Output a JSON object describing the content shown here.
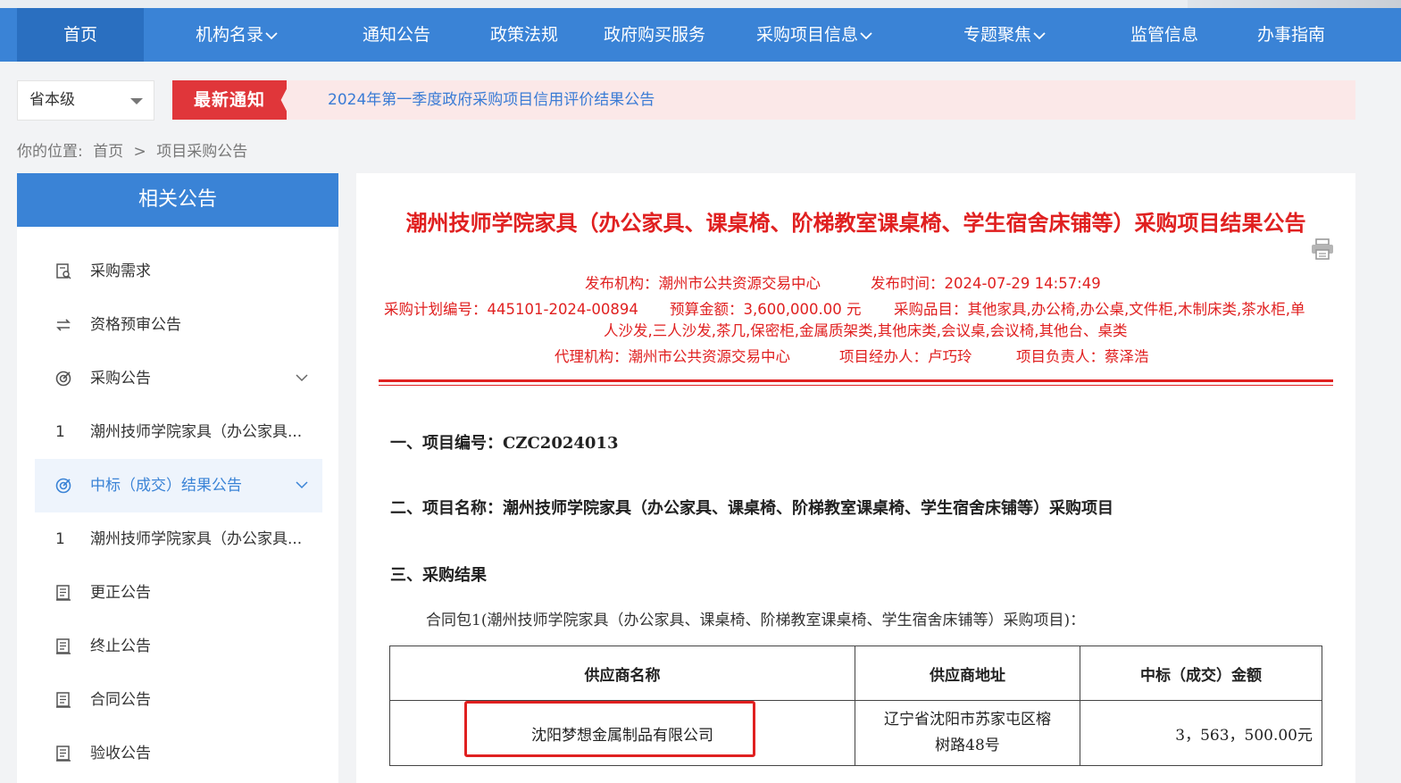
{
  "nav": {
    "items": [
      {
        "label": "首页",
        "dropdown": false
      },
      {
        "label": "机构名录",
        "dropdown": true
      },
      {
        "label": "通知公告",
        "dropdown": false
      },
      {
        "label": "政策法规",
        "dropdown": false
      },
      {
        "label": "政府购买服务",
        "dropdown": false
      },
      {
        "label": "采购项目信息",
        "dropdown": true
      },
      {
        "label": "专题聚焦",
        "dropdown": true
      },
      {
        "label": "监管信息",
        "dropdown": false
      },
      {
        "label": "办事指南",
        "dropdown": false
      }
    ]
  },
  "level_select": {
    "value": "省本级"
  },
  "notice": {
    "badge": "最新通知",
    "text": "2024年第一季度政府采购项目信用评价结果公告"
  },
  "breadcrumb": {
    "prefix": "你的位置:",
    "home": "首页",
    "sep": ">",
    "current": "项目采购公告"
  },
  "sidebar": {
    "title": "相关公告",
    "items": [
      {
        "label": "采购需求",
        "icon": "doc-search-icon"
      },
      {
        "label": "资格预审公告",
        "icon": "swap-icon"
      },
      {
        "label": "采购公告",
        "icon": "target-icon",
        "expandable": true
      },
      {
        "num": "1",
        "label": "潮州技师学院家具（办公家具..."
      },
      {
        "label": "中标（成交）结果公告",
        "icon": "target-icon",
        "expandable": true,
        "active": true
      },
      {
        "num": "1",
        "label": "潮州技师学院家具（办公家具..."
      },
      {
        "label": "更正公告",
        "icon": "doc-list-icon"
      },
      {
        "label": "终止公告",
        "icon": "doc-list-icon"
      },
      {
        "label": "合同公告",
        "icon": "doc-list-icon"
      },
      {
        "label": "验收公告",
        "icon": "doc-list-icon"
      }
    ]
  },
  "doc": {
    "title": "潮州技师学院家具（办公家具、课桌椅、阶梯教室课桌椅、学生宿舍床铺等）采购项目结果公告",
    "publisher": "发布机构：潮州市公共资源交易中心",
    "publish_time": "发布时间：2024-07-29 14:57:49",
    "plan_no": "采购计划编号：445101-2024-00894",
    "budget": "预算金额：3,600,000.00 元",
    "items_line1": "采购品目：其他家具,办公椅,办公桌,文件柜,木制床类,茶水柜,单",
    "items_line2": "人沙发,三人沙发,茶几,保密柜,金属质架类,其他床类,会议桌,会议椅,其他台、桌类",
    "agency": "代理机构：潮州市公共资源交易中心",
    "handler": "项目经办人：卢巧玲",
    "manager": "项目负责人：蔡泽浩",
    "sec1": "一、项目编号：CZC2024013",
    "sec2": "二、项目名称：潮州技师学院家具（办公家具、课桌椅、阶梯教室课桌椅、学生宿舍床铺等）采购项目",
    "sec3": "三、采购结果",
    "package": "合同包1(潮州技师学院家具（办公家具、课桌椅、阶梯教室课桌椅、学生宿舍床铺等）采购项目)：",
    "table": {
      "headers": [
        "供应商名称",
        "供应商地址",
        "中标（成交）金额"
      ],
      "rows": [
        {
          "name": "沈阳梦想金属制品有限公司",
          "address_line1": "辽宁省沈阳市苏家屯区榕",
          "address_line2": "树路48号",
          "amount": "3，563，500.00元"
        }
      ]
    }
  }
}
